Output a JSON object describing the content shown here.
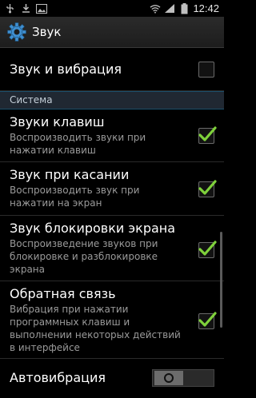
{
  "status_bar": {
    "time": "12:42",
    "icons": [
      "usb-icon",
      "download-icon",
      "gallery-icon",
      "wifi-icon",
      "signal-icon",
      "battery-icon"
    ]
  },
  "action_bar": {
    "title": "Звук",
    "icon": "gear-icon"
  },
  "settings": {
    "sound_vibration": {
      "title": "Звук и вибрация",
      "checked": false
    },
    "section_system": "Система",
    "key_tones": {
      "title": "Звуки клавиш",
      "subtitle": "Воспроизводить звуки при нажатии клавиш",
      "checked": true
    },
    "touch_sounds": {
      "title": "Звук при касании",
      "subtitle": "Воспроизводить звук при нажатии на экран",
      "checked": true
    },
    "lock_sound": {
      "title": "Звук блокировки экрана",
      "subtitle": "Воспроизведение звуков при блокировке и разблокировке экрана",
      "checked": true
    },
    "haptic_feedback": {
      "title": "Обратная связь",
      "subtitle": "Вибрация при нажатии программных клавиш и выполнении некоторых действий в интерфейсе",
      "checked": true
    },
    "auto_vibration": {
      "title": "Автовибрация",
      "state": "off"
    }
  },
  "colors": {
    "check": "#7fd13b",
    "section_bg": "#202832",
    "background": "#000000"
  }
}
